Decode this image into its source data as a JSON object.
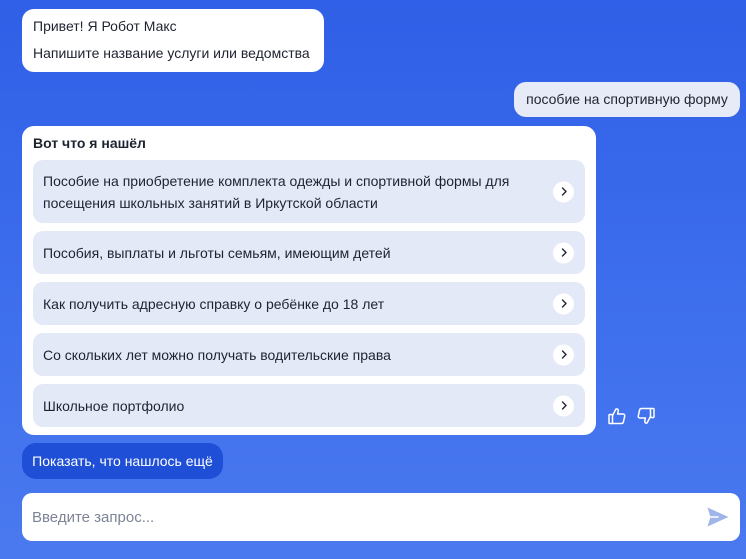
{
  "greeting": {
    "line1": "Привет! Я Робот Макс",
    "line2": "Напишите название услуги или ведомства"
  },
  "user_message": "пособие на спортивную форму",
  "results": {
    "title": "Вот что я нашёл",
    "items": [
      {
        "line1": "Пособие на приобретение комплекта одежды и спортивной формы для",
        "line2": "посещения школьных занятий в Иркутской области"
      },
      {
        "line1": "Пособия, выплаты и льготы семьям, имеющим детей"
      },
      {
        "line1": "Как получить адресную справку о ребёнке до 18 лет"
      },
      {
        "line1": "Со скольких лет можно получать водительские права"
      },
      {
        "line1": "Школьное портфолио"
      }
    ]
  },
  "feedback": {
    "like_icon": "thumbs-up-icon",
    "dislike_icon": "thumbs-down-icon"
  },
  "show_more_label": "Показать, что нашлось ещё",
  "input": {
    "placeholder": "Введите запрос...",
    "value": ""
  },
  "icons": {
    "chevron": "chevron-right-icon",
    "send": "send-icon"
  },
  "colors": {
    "background": "#3b6cec",
    "accent_button": "#1f4fd6",
    "item_bg": "#e4e9f8",
    "send_icon": "#9fb4e8"
  }
}
